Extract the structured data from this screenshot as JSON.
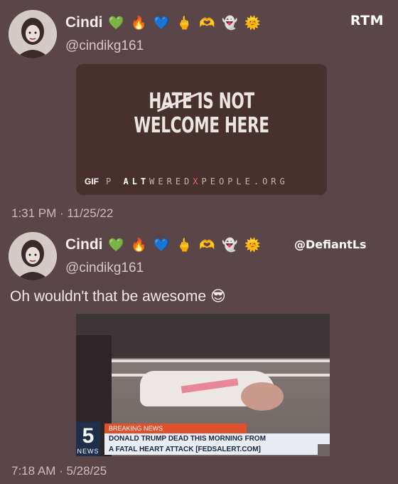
{
  "watermark": "RTM",
  "credit": "@DefiantLs",
  "tweets": [
    {
      "name": "Cindi",
      "handle": "@cindikg161",
      "emojis": [
        "💚",
        "🔥",
        "💙",
        "🖕",
        "🫶",
        "👻",
        "🌞"
      ],
      "gif": {
        "line1": "HATE IS NOT",
        "line2": "WELCOME HERE",
        "badge_gif": "GIF",
        "badge_alt": "ALT",
        "url_prefix": "P ",
        "url_a": "WERED",
        "url_x": "X",
        "url_b": "PEOPLE.ORG"
      },
      "timestamp": "1:31 PM · 11/25/22"
    },
    {
      "name": "Cindi",
      "handle": "@cindikg161",
      "emojis": [
        "💚",
        "🔥",
        "💙",
        "🖕",
        "🫶",
        "👻",
        "🌞"
      ],
      "text": "Oh wouldn't that be awesome",
      "text_emoji": "😎",
      "photo": {
        "channel_number": "5",
        "channel_tag": "NEWS",
        "breaking": "BREAKING NEWS",
        "headline1": "DONALD TRUMP DEAD THIS MORNING FROM",
        "headline2": "A FATAL HEART ATTACK [FEDSALERT.COM]"
      },
      "timestamp": "7:18 AM · 5/28/25"
    }
  ]
}
